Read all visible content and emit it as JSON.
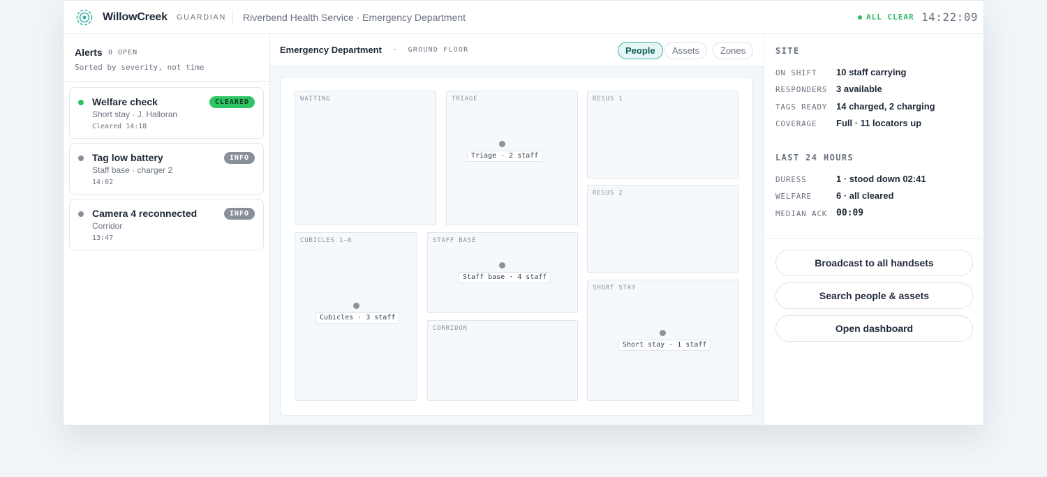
{
  "header": {
    "brand": "WillowCreek",
    "brand_sub": "GUARDIAN",
    "breadcrumb": "Riverbend Health Service · Emergency Department",
    "status": "ALL CLEAR",
    "clock": "14:22:09",
    "status_color": "#2fb866"
  },
  "alerts": {
    "title": "Alerts",
    "count": "0 OPEN",
    "subtitle": "Sorted by severity, not time",
    "items": [
      {
        "title": "Welfare check",
        "subtitle": "Short stay · J. Halloran",
        "time": "Cleared 14:18",
        "badge": "CLEARED",
        "color": "#2fc464"
      },
      {
        "title": "Tag low battery",
        "subtitle": "Staff base · charger 2",
        "time": "14:02",
        "badge": "INFO",
        "color": "#8a909a"
      },
      {
        "title": "Camera 4 reconnected",
        "subtitle": "Corridor",
        "time": "13:47",
        "badge": "INFO",
        "color": "#8a909a"
      }
    ]
  },
  "map": {
    "title": "Emergency Department",
    "floor": "GROUND FLOOR",
    "views": [
      "People",
      "Assets",
      "Zones"
    ],
    "active_view": "People",
    "zones": [
      {
        "label": "WAITING"
      },
      {
        "label": "TRIAGE",
        "marker": "Triage · 2 staff"
      },
      {
        "label": "RESUS 1"
      },
      {
        "label": "RESUS 2"
      },
      {
        "label": "CUBICLES 1–6",
        "marker": "Cubicles · 3 staff"
      },
      {
        "label": "STAFF BASE",
        "marker": "Staff base · 4 staff"
      },
      {
        "label": "CORRIDOR"
      },
      {
        "label": "SHORT STAY",
        "marker": "Short stay · 1 staff"
      }
    ]
  },
  "site": {
    "title": "SITE",
    "rows": [
      {
        "key": "ON SHIFT",
        "value": "10 staff carrying"
      },
      {
        "key": "RESPONDERS",
        "value": "3 available"
      },
      {
        "key": "TAGS READY",
        "value": "14 charged, 2 charging"
      },
      {
        "key": "COVERAGE",
        "value": "Full · 11 locators up"
      }
    ]
  },
  "last24": {
    "title": "LAST 24 HOURS",
    "rows": [
      {
        "key": "DURESS",
        "value": "1 · stood down 02:41"
      },
      {
        "key": "WELFARE",
        "value": "6 · all cleared"
      },
      {
        "key": "MEDIAN ACK",
        "value": "00:09"
      }
    ]
  },
  "actions": {
    "broadcast": "Broadcast to all handsets",
    "search": "Search people & assets",
    "dashboard": "Open dashboard"
  },
  "colors": {
    "accent": "#3fb3a8",
    "all_clear": "#2fb866"
  }
}
